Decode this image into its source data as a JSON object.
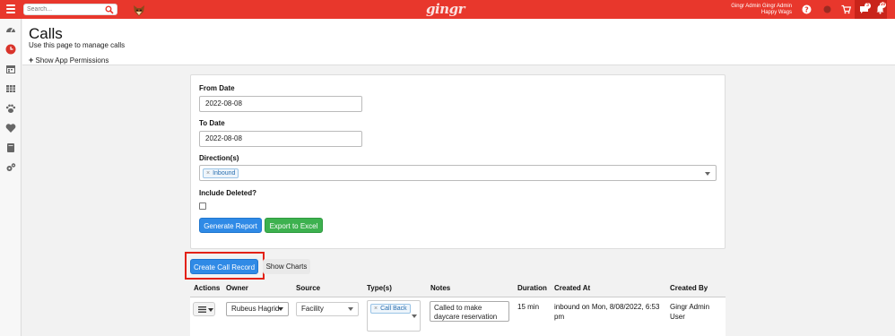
{
  "topbar": {
    "search_placeholder": "Search...",
    "logo": "gingr",
    "user_name": "Gingr Admin Gingr Admin",
    "user_company": "Happy Wags",
    "badges": [
      "3",
      "10"
    ]
  },
  "header": {
    "title": "Calls",
    "subtitle": "Use this page to manage calls",
    "permissions_link": "Show App Permissions"
  },
  "form": {
    "from_date_label": "From Date",
    "from_date_value": "2022-08-08",
    "to_date_label": "To Date",
    "to_date_value": "2022-08-08",
    "direction_label": "Direction(s)",
    "direction_tag": "Inbound",
    "include_deleted_label": "Include Deleted?",
    "generate_button": "Generate Report",
    "export_button": "Export to Excel"
  },
  "actions": {
    "create_call_record": "Create Call Record",
    "show_charts": "Show Charts"
  },
  "table": {
    "headers": [
      "Actions",
      "Owner",
      "Source",
      "Type(s)",
      "Notes",
      "Duration",
      "Created At",
      "Created By"
    ],
    "row": {
      "owner": "Rubeus Hagrid",
      "source": "Facility",
      "type_tag": "Call Back",
      "notes": "Called to make daycare reservation",
      "duration": "15 min",
      "created_at": "inbound on Mon, 8/08/2022, 6:53 pm",
      "created_by": "Gingr Admin User"
    }
  },
  "colors": {
    "topbar": "#e8372c",
    "primary_button": "#2f8ae6",
    "success_button": "#3db14f",
    "highlight_outline": "#e32116"
  }
}
